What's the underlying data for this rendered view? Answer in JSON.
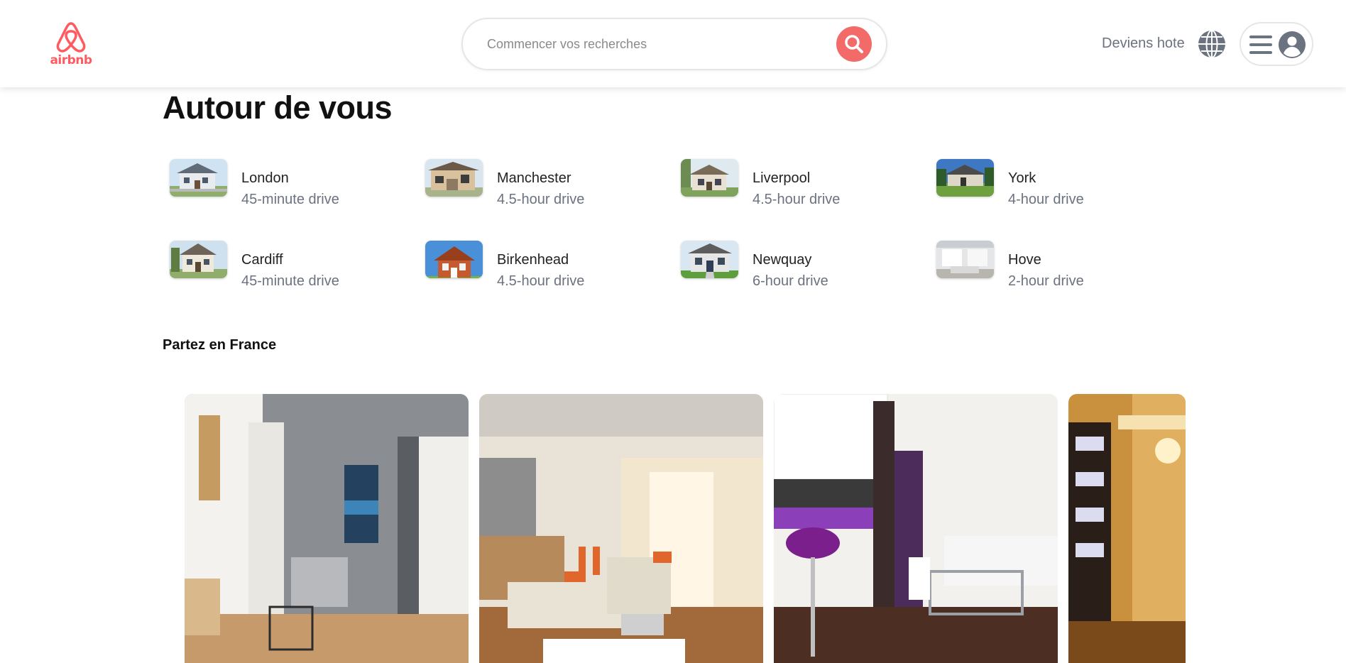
{
  "header": {
    "logo_text": "airbnb",
    "search_placeholder": "Commencer vos recherches",
    "host_link": "Deviens hote"
  },
  "nearby": {
    "title": "Autour de vous",
    "places": [
      {
        "name": "London",
        "drive": "45-minute drive"
      },
      {
        "name": "Manchester",
        "drive": "4.5-hour drive"
      },
      {
        "name": "Liverpool",
        "drive": "4.5-hour drive"
      },
      {
        "name": "York",
        "drive": "4-hour drive"
      },
      {
        "name": "Cardiff",
        "drive": "45-minute drive"
      },
      {
        "name": "Birkenhead",
        "drive": "4.5-hour drive"
      },
      {
        "name": "Newquay",
        "drive": "6-hour drive"
      },
      {
        "name": "Hove",
        "drive": "2-hour drive"
      }
    ]
  },
  "france": {
    "title": "Partez en France"
  },
  "colors": {
    "brand": "#FF5A5F",
    "search_button": "#f26b68",
    "muted_text": "#6b7280"
  }
}
